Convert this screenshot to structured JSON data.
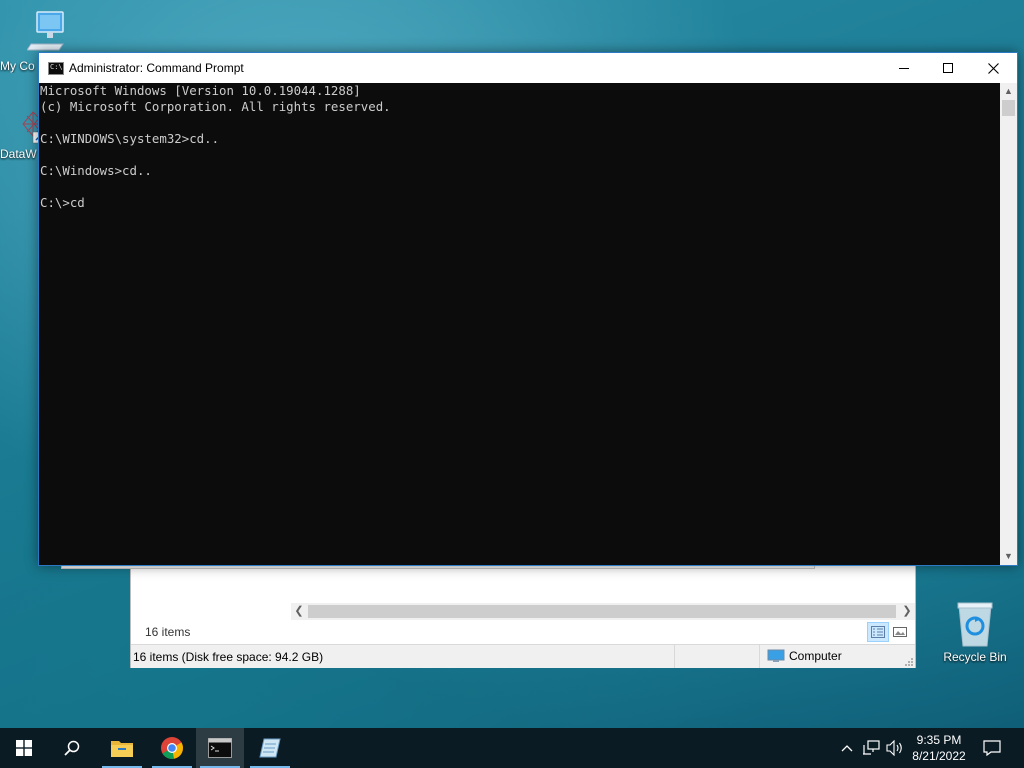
{
  "desktop": {
    "icons": [
      {
        "label": "My Co",
        "icon": "computer-icon"
      },
      {
        "label": "DataW",
        "icon": "shortcut-icon"
      },
      {
        "label": "Recycle Bin",
        "icon": "recycle-bin-icon"
      }
    ]
  },
  "explorer": {
    "items_count": "16 items",
    "status_left": "16 items (Disk free space: 94.2 GB)",
    "status_right": "Computer",
    "views": [
      "details-view-icon",
      "large-icons-view-icon"
    ]
  },
  "cmd": {
    "title": "Administrator: Command Prompt",
    "icon_text": "C:\\",
    "lines": [
      "Microsoft Windows [Version 10.0.19044.1288]",
      "(c) Microsoft Corporation. All rights reserved.",
      "",
      "C:\\WINDOWS\\system32>cd..",
      "",
      "C:\\Windows>cd..",
      "",
      "C:\\>cd"
    ],
    "text_color": "#cccccc",
    "background": "#0c0c0c"
  },
  "taskbar": {
    "apps": [
      "start-icon",
      "search-icon",
      "file-explorer-icon",
      "chrome-icon",
      "command-prompt-icon",
      "notepad-icon"
    ],
    "tray": [
      "chevron-up-icon",
      "network-icon",
      "volume-icon",
      "notification-icon"
    ],
    "time": "9:35 PM",
    "date": "8/21/2022",
    "accent": "#76b9ed"
  }
}
